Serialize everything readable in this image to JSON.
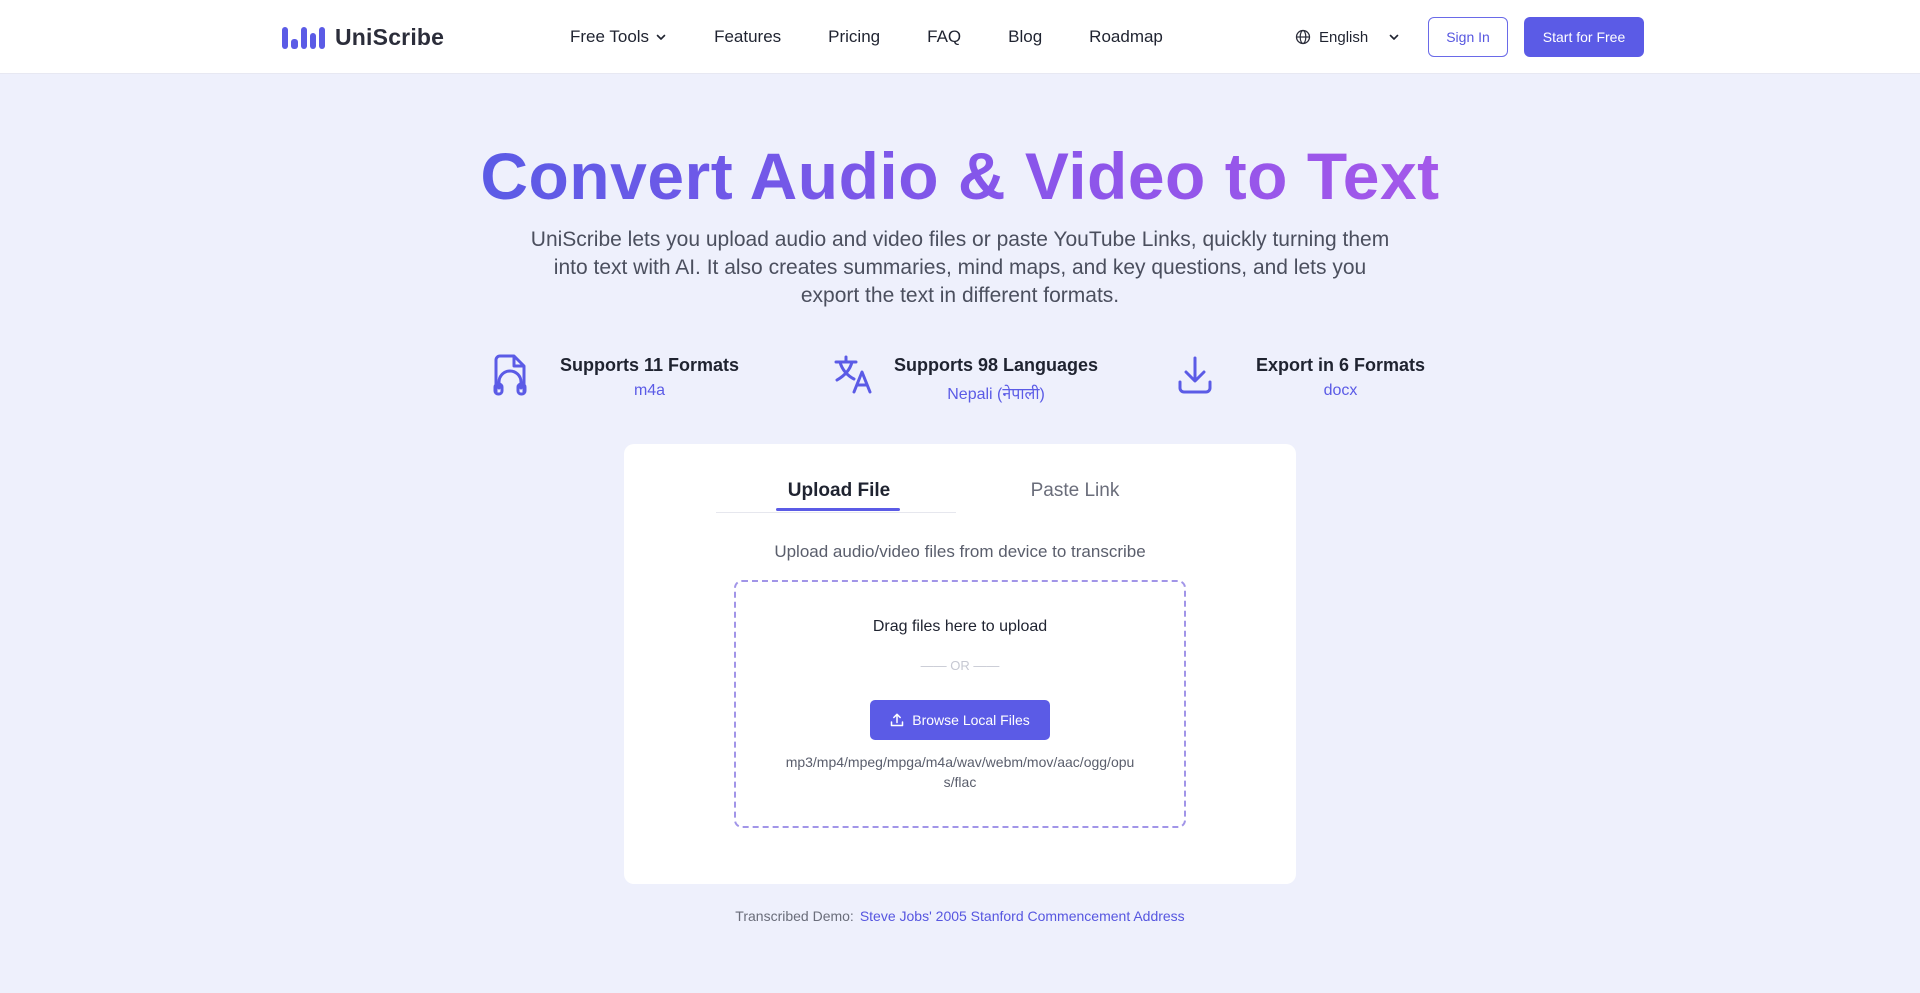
{
  "header": {
    "brand": "UniScribe",
    "nav": [
      {
        "label": "Free Tools",
        "icon": "chevron-down-icon"
      },
      {
        "label": "Features"
      },
      {
        "label": "Pricing"
      },
      {
        "label": "FAQ"
      },
      {
        "label": "Blog"
      },
      {
        "label": "Roadmap"
      }
    ],
    "language": "English",
    "sign_in": "Sign In",
    "start": "Start for Free"
  },
  "hero": {
    "title": "Convert Audio & Video to Text",
    "subtitle": "UniScribe lets you upload audio and video files or paste YouTube Links, quickly turning them into text with AI. It also creates summaries, mind maps, and key questions, and lets you export the text in different formats."
  },
  "features": [
    {
      "title": "Supports 11 Formats",
      "sub": "m4a",
      "icon": "audio-file-icon"
    },
    {
      "title": "Supports 98 Languages",
      "sub": "Nepali (नेपाली)",
      "icon": "translate-icon"
    },
    {
      "title": "Export in 6 Formats",
      "sub": "docx",
      "icon": "download-icon"
    }
  ],
  "uploader": {
    "tabs": [
      "Upload File",
      "Paste Link"
    ],
    "active_tab": "Upload File",
    "hint": "Upload audio/video files from device to transcribe",
    "drag_text": "Drag files here to upload",
    "or_text": "—— OR ——",
    "browse_label": "Browse Local Files",
    "formats": "mp3/mp4/mpeg/mpga/m4a/wav/webm/mov/aac/ogg/opus/flac"
  },
  "demo": {
    "label": "Transcribed Demo:",
    "link": "Steve Jobs' 2005 Stanford Commencement Address"
  },
  "colors": {
    "accent": "#5b5be6",
    "gradient_end": "#a458ea",
    "background": "#eef0fc"
  }
}
